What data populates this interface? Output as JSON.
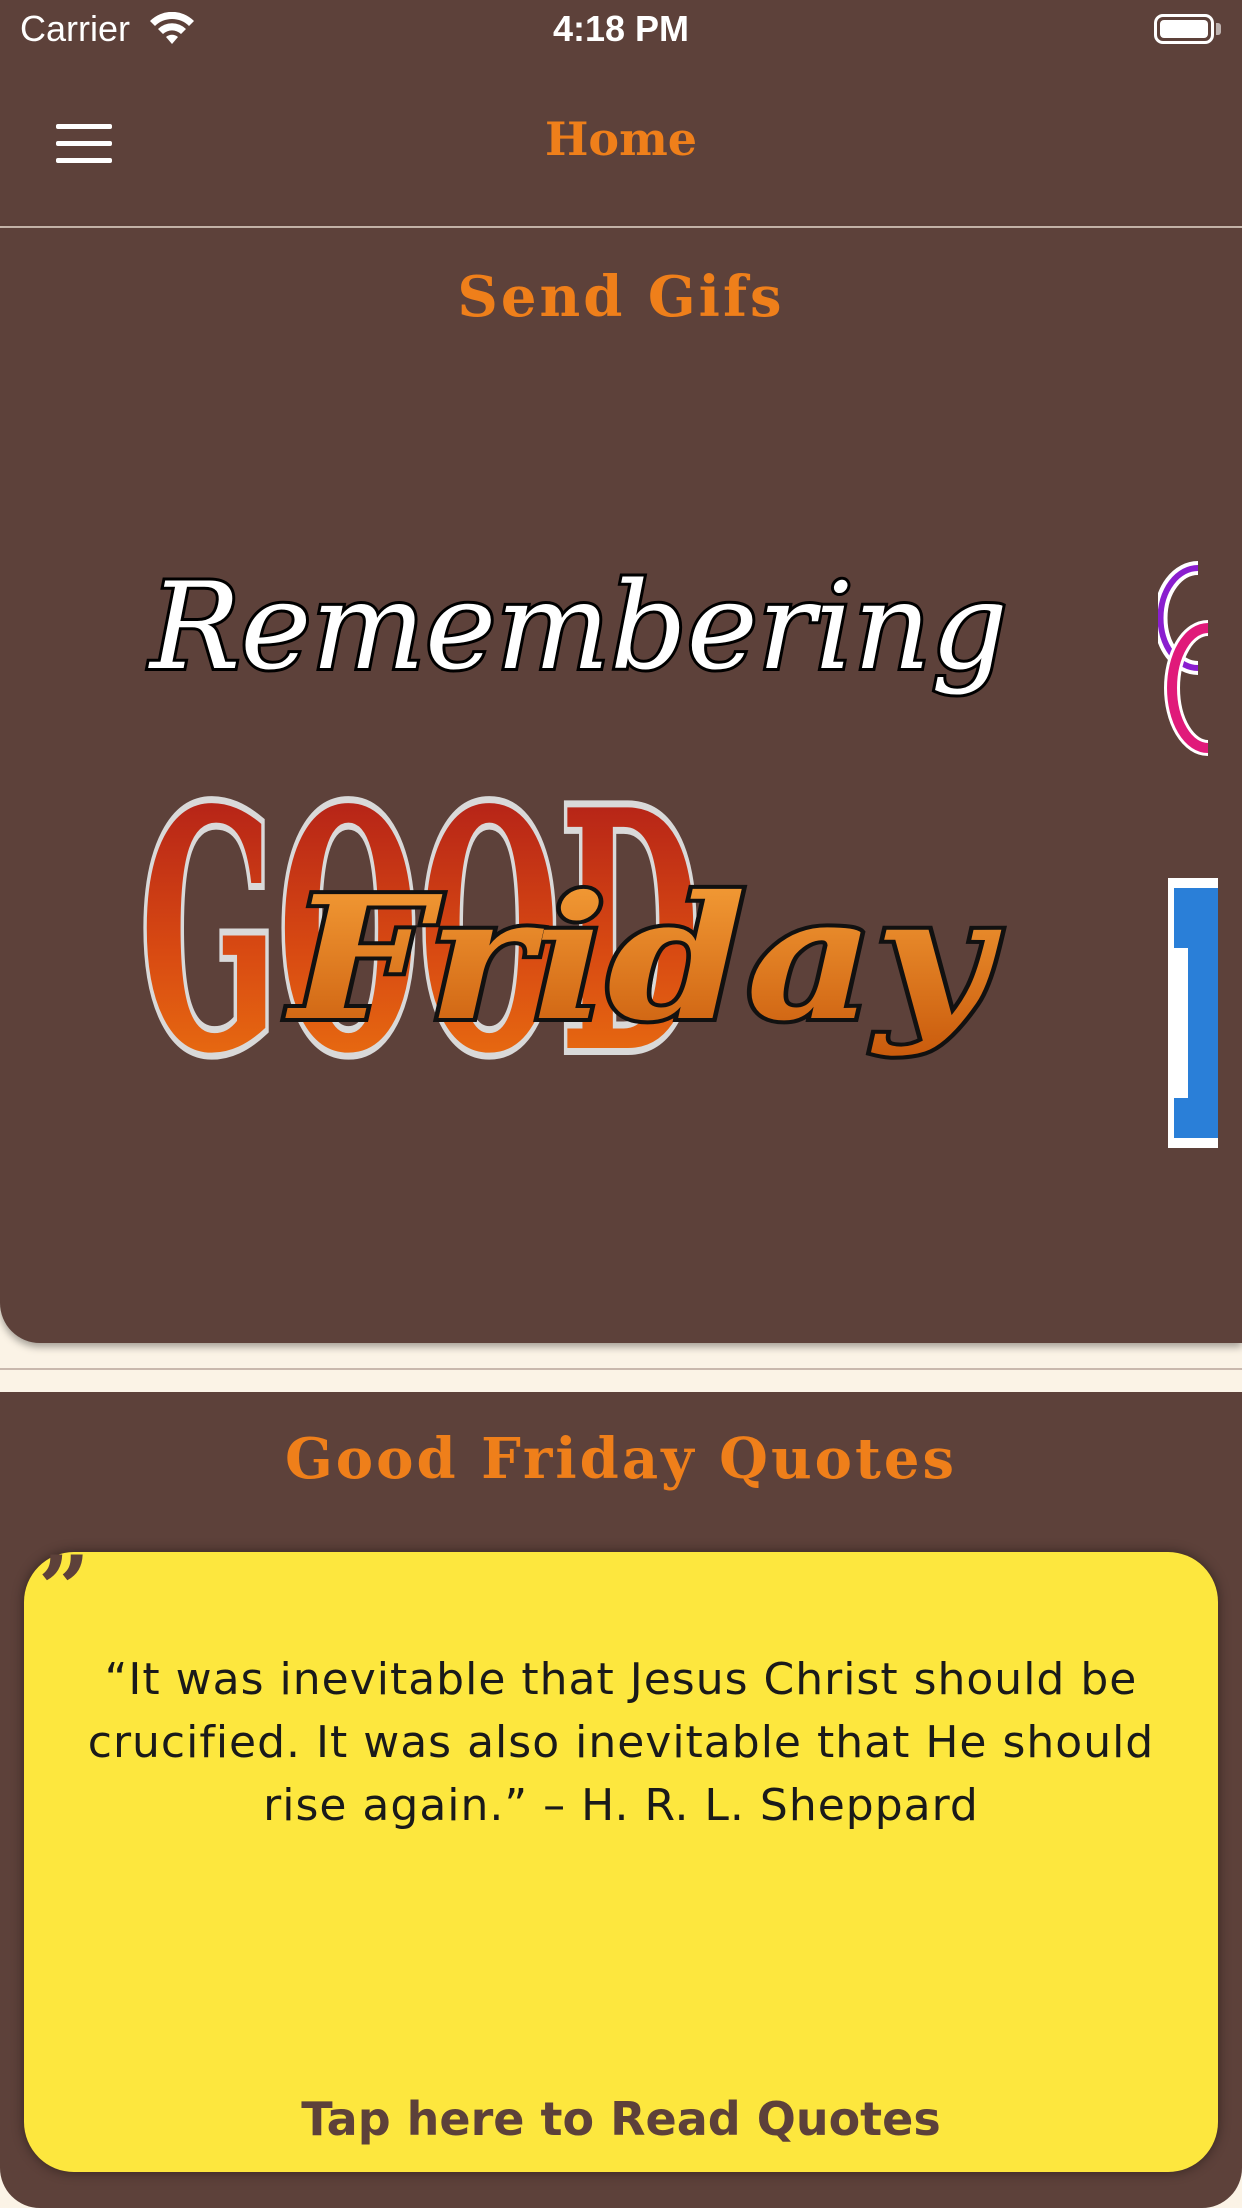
{
  "status_bar": {
    "carrier": "Carrier",
    "time": "4:18 PM"
  },
  "nav": {
    "title": "Home",
    "menu_icon": "hamburger-menu-icon"
  },
  "gifs_section": {
    "title": "Send Gifs",
    "gif": {
      "line1": "Remembering",
      "line2": "GOOD",
      "line3": "Friday"
    }
  },
  "quotes_section": {
    "title": "Good Friday Quotes",
    "quote_icon": "quote-mark-icon",
    "quote_mark": "”",
    "quote_text": "“It was inevitable that Jesus Christ should be crucified. It was also inevitable that He should rise again.” – H. R. L. Sheppard",
    "cta": "Tap here to Read Quotes"
  },
  "colors": {
    "bar_bg": "#5d413a",
    "accent_orange": "#ef7f1a",
    "quote_bg": "#fde73e",
    "page_bg": "#fbf3e6"
  }
}
